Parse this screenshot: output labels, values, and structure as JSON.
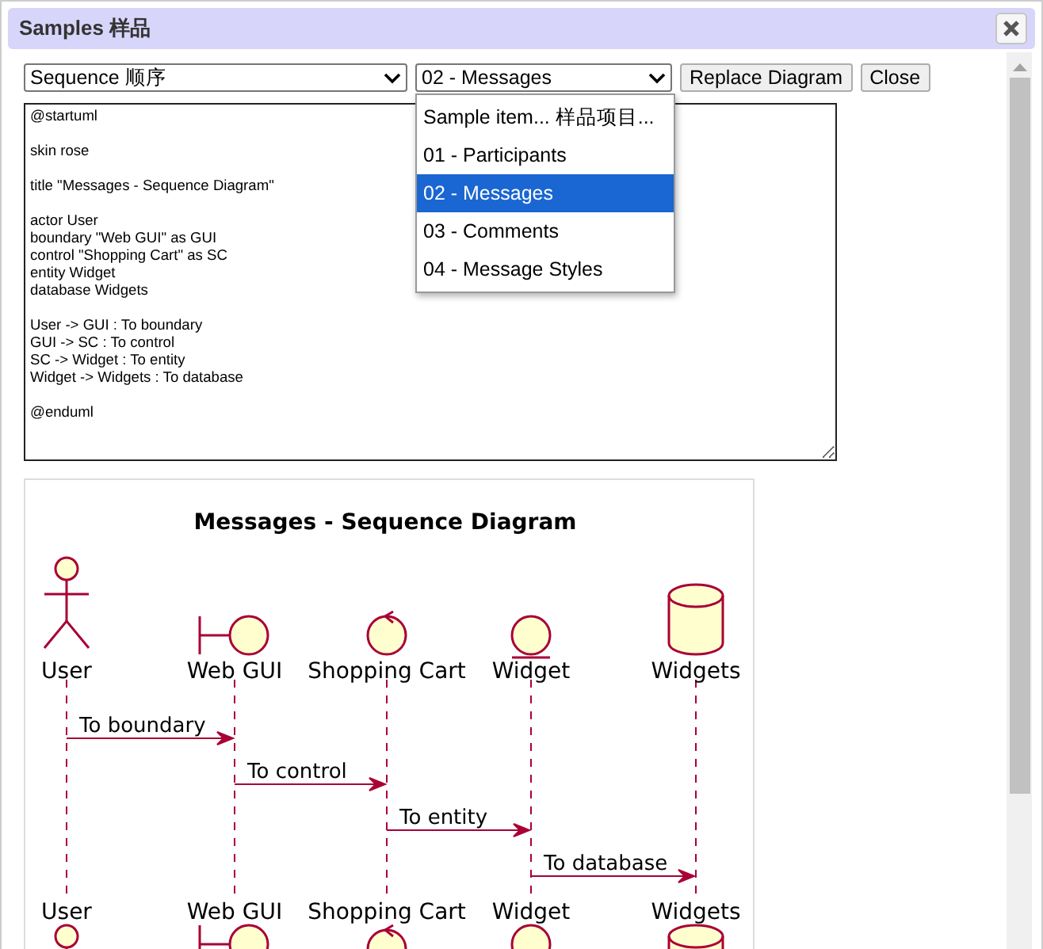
{
  "window": {
    "title": "Samples 样品"
  },
  "toolbar": {
    "category_select": "Sequence 顺序",
    "sample_select": "02 - Messages",
    "buttons": [
      "Replace Diagram",
      "Close"
    ]
  },
  "dropdown": {
    "options": [
      {
        "label": "Sample item... 样品项目...",
        "selected": false
      },
      {
        "label": "01 - Participants",
        "selected": false
      },
      {
        "label": "02 - Messages",
        "selected": true
      },
      {
        "label": "03 - Comments",
        "selected": false
      },
      {
        "label": "04 - Message Styles",
        "selected": false
      }
    ]
  },
  "editor": {
    "value": "@startuml\n\nskin rose\n\ntitle \"Messages - Sequence Diagram\"\n\nactor User\nboundary \"Web GUI\" as GUI\ncontrol \"Shopping Cart\" as SC\nentity Widget\ndatabase Widgets\n\nUser -> GUI : To boundary\nGUI -> SC : To control\nSC -> Widget : To entity\nWidget -> Widgets : To database\n\n@enduml"
  },
  "diagram": {
    "title": "Messages - Sequence Diagram",
    "participants": [
      {
        "kind": "actor",
        "name": "User",
        "bottom_name": "User"
      },
      {
        "kind": "boundary",
        "name": "Web GUI",
        "bottom_name": "Web GUI"
      },
      {
        "kind": "control",
        "name": "Shopping Cart",
        "bottom_name": "Shopping Cart"
      },
      {
        "kind": "entity",
        "name": "Widget",
        "bottom_name": "Widget"
      },
      {
        "kind": "database",
        "name": "Widgets",
        "bottom_name": "Widgets"
      }
    ],
    "messages": [
      {
        "label": "To boundary"
      },
      {
        "label": "To control"
      },
      {
        "label": "To entity"
      },
      {
        "label": "To database"
      }
    ]
  }
}
